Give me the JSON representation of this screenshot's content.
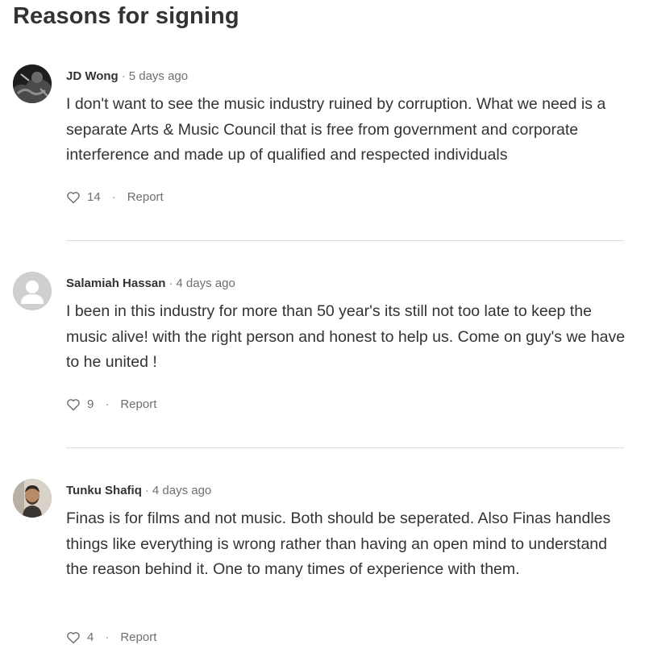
{
  "section": {
    "title": "Reasons for signing"
  },
  "comments": [
    {
      "author": "JD Wong",
      "separator": "·",
      "time": "5 days ago",
      "text": "I don't want to see the music industry ruined by corruption. What we need is a separate Arts & Music Council that is free from government and corporate interference and made up of qualified and respected individuals",
      "likes": "14",
      "action_separator": "·",
      "report_label": "Report",
      "avatar_icon": "user-photo-icon"
    },
    {
      "author": "Salamiah Hassan",
      "separator": "·",
      "time": "4 days ago",
      "text": "I been in this industry for more than 50 year's its still not too late to keep the music alive! with the right person and honest to help us. Come on guy's we have to he united !",
      "likes": "9",
      "action_separator": "·",
      "report_label": "Report",
      "avatar_icon": "default-user-icon"
    },
    {
      "author": "Tunku Shafiq",
      "separator": "·",
      "time": "4 days ago",
      "text": "Finas is for films and not music. Both should be seperated. Also Finas handles things like everything is wrong rather than having an open mind to understand the reason behind it. One to many times of experience with them.",
      "likes": "4",
      "action_separator": "·",
      "report_label": "Report",
      "avatar_icon": "user-photo-icon"
    }
  ],
  "colors": {
    "text": "#333333",
    "muted": "#6f6f6f",
    "divider": "#dddddd",
    "default_avatar_bg": "#cfcfcf",
    "default_avatar_fg": "#ffffff"
  }
}
